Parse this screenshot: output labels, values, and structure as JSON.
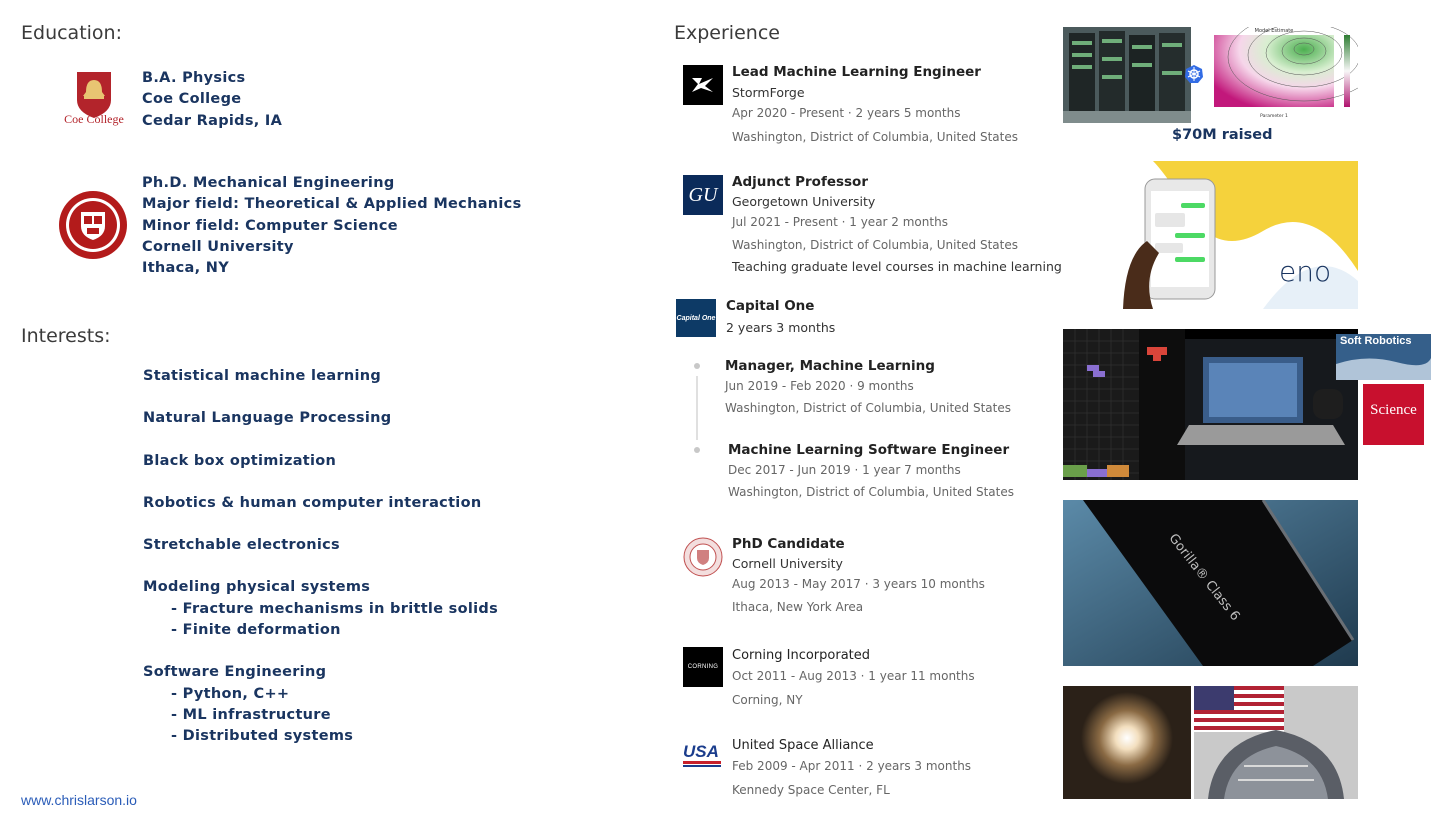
{
  "education": {
    "heading": "Education",
    "coe": {
      "logo_text": "Coe College",
      "lines": [
        "B.A. Physics",
        "Coe College",
        "Cedar Rapids, IA"
      ]
    },
    "cornell": {
      "lines": [
        "Ph.D. Mechanical Engineering",
        "Major field: Theoretical & Applied Mechanics",
        "Minor field: Computer Science",
        "Cornell University",
        "Ithaca, NY"
      ]
    }
  },
  "interests": {
    "heading": "Interests",
    "items": [
      "Statistical machine learning",
      "Natural Language Processing",
      "Black box optimization",
      "Robotics & human computer interaction",
      "Stretchable electronics",
      "Modeling physical systems",
      "- Fracture mechanisms in brittle solids",
      "- Finite deformation",
      "Software Engineering",
      "- Python, C++",
      "- ML infrastructure",
      "- Distributed systems"
    ]
  },
  "footer": {
    "url": "www.chrislarson.io"
  },
  "experience": {
    "heading": "Experience",
    "stormforge": {
      "title": "Lead Machine Learning Engineer",
      "company": "StormForge",
      "dates": "Apr 2020 - Present · 2 years 5 months",
      "location": "Washington, District of Columbia, United States"
    },
    "georgetown": {
      "logo_text": "GU",
      "title": "Adjunct Professor",
      "company": "Georgetown University",
      "dates": "Jul 2021 - Present · 1 year 2 months",
      "location": "Washington, District of Columbia, United States",
      "description": "Teaching graduate level courses in machine learning"
    },
    "capitalone": {
      "logo_text": "Capital One",
      "company": "Capital One",
      "duration": "2 years 3 months",
      "roles": [
        {
          "title": "Manager, Machine Learning",
          "dates": "Jun 2019 - Feb 2020 · 9 months",
          "location": "Washington, District of Columbia, United States"
        },
        {
          "title": "Machine Learning Software Engineer",
          "dates": "Dec 2017 - Jun 2019 · 1 year 7 months",
          "location": "Washington, District of Columbia, United States"
        }
      ]
    },
    "cornell": {
      "title": "PhD Candidate",
      "company": "Cornell University",
      "dates": "Aug 2013 - May 2017 · 3 years 10 months",
      "location": "Ithaca, New York Area"
    },
    "corning": {
      "logo_text": "CORNING",
      "company": "Corning Incorporated",
      "dates": "Oct 2011 - Aug 2013 · 1 year 11 months",
      "location": "Corning, NY"
    },
    "usa": {
      "logo_text": "USA",
      "company": "United Space Alliance",
      "dates": "Feb 2009 - Apr 2011 · 2 years 3 months",
      "location": "Kennedy Space Center, FL"
    }
  },
  "gallery": {
    "stormforge_caption": "$70M raised",
    "plot_title": "Model Estimate",
    "plot_xlabel": "Parameter 1",
    "eno_text": "eno",
    "soft_robotics_text": "Soft Robotics",
    "science_text": "Science",
    "gorilla_text": "Gorilla® Class 6"
  }
}
